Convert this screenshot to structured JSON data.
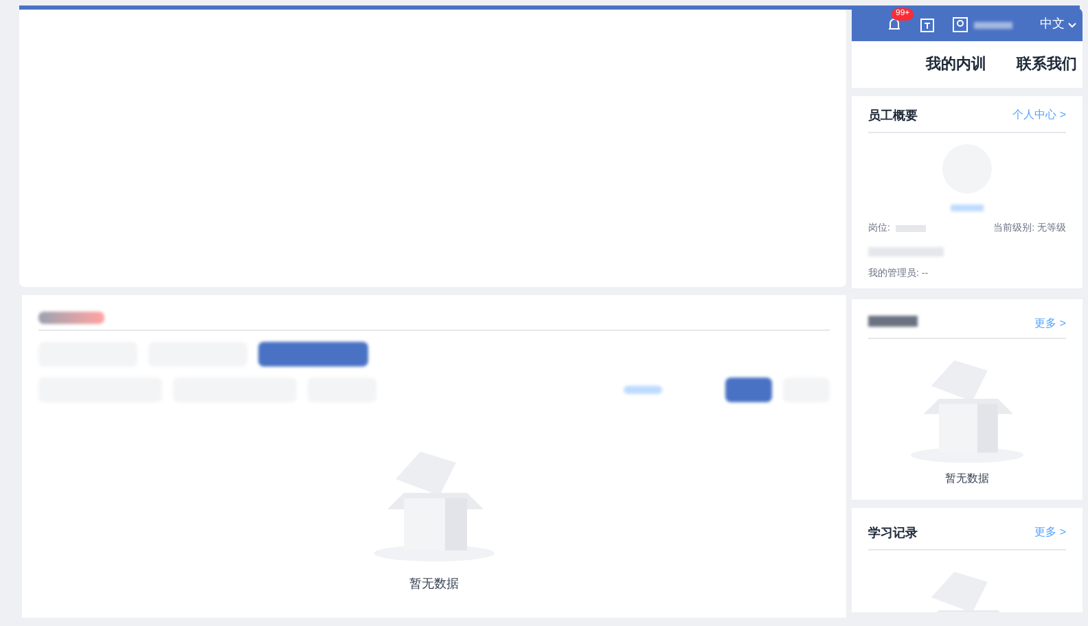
{
  "header": {
    "badge": "99+",
    "language": "中文"
  },
  "nav": [
    "我的内训",
    "联系我们"
  ],
  "profile": {
    "title": "员工概要",
    "link": "个人中心 >",
    "position_label": "岗位:",
    "level_label": "当前级别:",
    "level_value": "无等级",
    "manager_label": "我的管理员:",
    "manager_value": "--"
  },
  "tabs": [
    {
      "selected": false
    },
    {
      "selected": false
    },
    {
      "selected": true
    }
  ],
  "main_empty": "暂无数据",
  "side_cards": [
    {
      "link": "更多 >",
      "empty": "暂无数据"
    },
    {
      "title": "学习记录",
      "link": "更多 >"
    }
  ]
}
